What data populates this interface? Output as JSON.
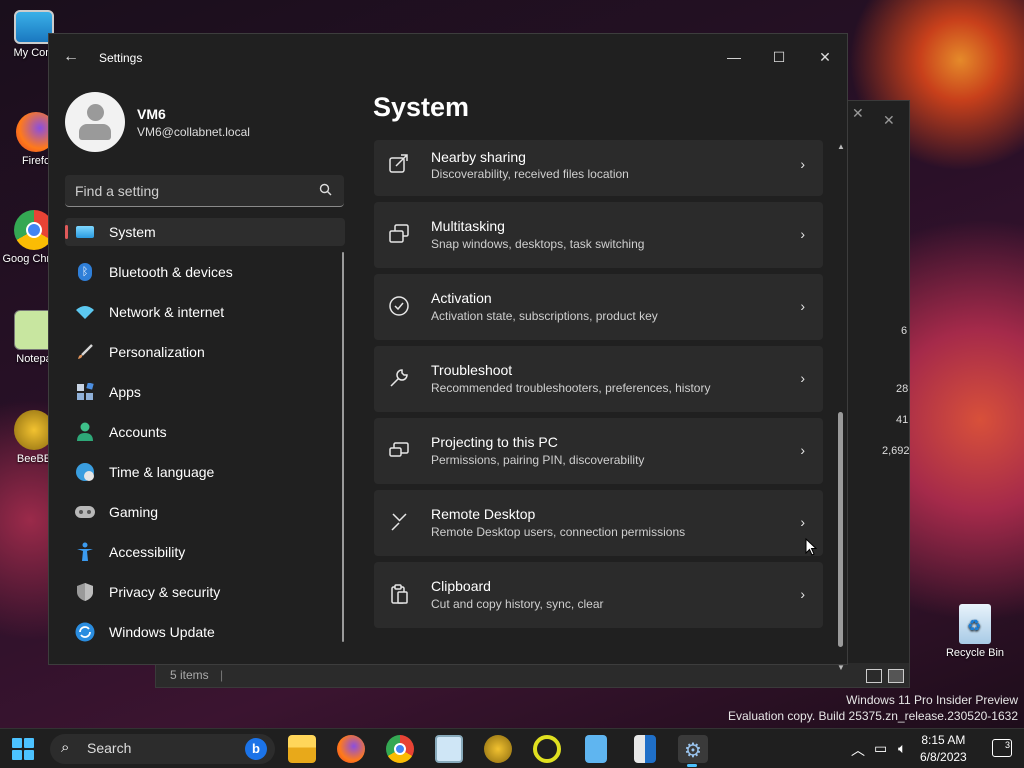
{
  "desktop": {
    "icons": [
      {
        "label": "My Com",
        "icon": "computer-icon"
      },
      {
        "label": "Firefo",
        "icon": "firefox-icon"
      },
      {
        "label": "Goog Chrom",
        "icon": "chrome-icon"
      },
      {
        "label": "Notepa",
        "icon": "notepad-icon"
      },
      {
        "label": "BeeBE",
        "icon": "bee-icon"
      },
      {
        "label": "Recycle Bin",
        "icon": "recycle-bin-icon"
      }
    ],
    "background_window": {
      "status_text": "5 items",
      "numbers": [
        "6",
        "28",
        "41",
        "2,692"
      ]
    },
    "watermark": {
      "line1": "Windows 11 Pro Insider Preview",
      "line2": "Evaluation copy. Build 25375.zn_release.230520-1632"
    }
  },
  "settings": {
    "app_title": "Settings",
    "back_icon": "back-arrow-icon",
    "window_controls": {
      "minimize": "—",
      "maximize": "☐",
      "close": "✕"
    },
    "profile": {
      "name": "VM6",
      "email": "VM6@collabnet.local"
    },
    "search": {
      "placeholder": "Find a setting"
    },
    "nav": [
      {
        "label": "System",
        "icon": "system-icon",
        "active": true,
        "color": "#4cc2ff"
      },
      {
        "label": "Bluetooth & devices",
        "icon": "bluetooth-icon",
        "color": "#3b8de0"
      },
      {
        "label": "Network & internet",
        "icon": "wifi-icon",
        "color": "#5cc8f0"
      },
      {
        "label": "Personalization",
        "icon": "brush-icon",
        "color": "#e0935a"
      },
      {
        "label": "Apps",
        "icon": "apps-icon",
        "color": "#8fb0d8"
      },
      {
        "label": "Accounts",
        "icon": "accounts-icon",
        "color": "#3ec08a"
      },
      {
        "label": "Time & language",
        "icon": "globe-icon",
        "color": "#3a9ee0"
      },
      {
        "label": "Gaming",
        "icon": "gamepad-icon",
        "color": "#b0b0b0"
      },
      {
        "label": "Accessibility",
        "icon": "accessibility-icon",
        "color": "#3b9bf0"
      },
      {
        "label": "Privacy & security",
        "icon": "shield-icon",
        "color": "#9a9a9a"
      },
      {
        "label": "Windows Update",
        "icon": "update-icon",
        "color": "#2a8de0"
      }
    ],
    "page_title": "System",
    "cards": [
      {
        "title": "Nearby sharing",
        "subtitle": "Discoverability, received files location",
        "icon": "share-icon"
      },
      {
        "title": "Multitasking",
        "subtitle": "Snap windows, desktops, task switching",
        "icon": "multitasking-icon"
      },
      {
        "title": "Activation",
        "subtitle": "Activation state, subscriptions, product key",
        "icon": "activation-icon"
      },
      {
        "title": "Troubleshoot",
        "subtitle": "Recommended troubleshooters, preferences, history",
        "icon": "wrench-icon"
      },
      {
        "title": "Projecting to this PC",
        "subtitle": "Permissions, pairing PIN, discoverability",
        "icon": "projecting-icon"
      },
      {
        "title": "Remote Desktop",
        "subtitle": "Remote Desktop users, connection permissions",
        "icon": "remote-desktop-icon"
      },
      {
        "title": "Clipboard",
        "subtitle": "Cut and copy history, sync, clear",
        "icon": "clipboard-icon"
      }
    ]
  },
  "taskbar": {
    "search_label": "Search",
    "apps": [
      "file-explorer-icon",
      "firefox-icon",
      "chrome-icon",
      "monitor-icon",
      "bee-icon",
      "ring-icon",
      "notepad-icon",
      "book-icon",
      "settings-gear-icon"
    ],
    "time": "8:15 AM",
    "date": "6/8/2023",
    "notification_count": "3"
  }
}
